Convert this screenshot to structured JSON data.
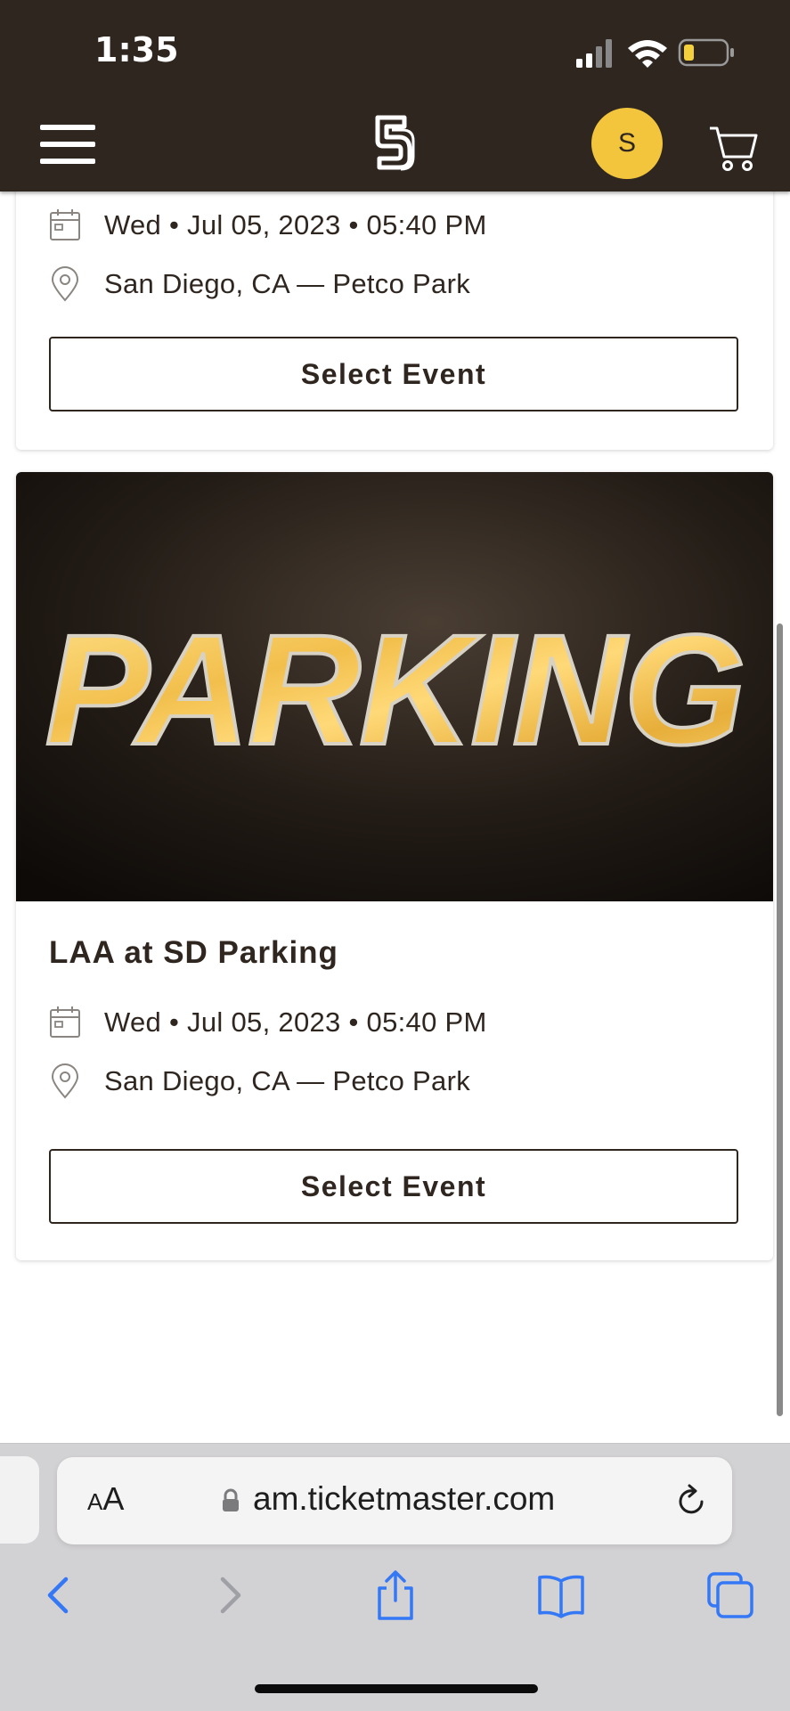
{
  "status_bar": {
    "time": "1:35"
  },
  "header": {
    "avatar_initial": "S",
    "brand_color": "#2f2620",
    "accent_color": "#f3c53c"
  },
  "events": [
    {
      "title": "",
      "date": "Wed • Jul 05, 2023 • 05:40 PM",
      "location": "San Diego, CA — Petco Park",
      "button_label": "Select Event"
    },
    {
      "image_text": "PARKING",
      "title": "LAA at SD Parking",
      "date": "Wed • Jul 05, 2023 • 05:40 PM",
      "location": "San Diego, CA — Petco Park",
      "button_label": "Select Event"
    }
  ],
  "browser": {
    "text_size_label_small": "A",
    "text_size_label_large": "A",
    "url": "am.ticketmaster.com",
    "toolbar_icons": [
      "back-icon",
      "forward-icon",
      "share-icon",
      "bookmarks-icon",
      "tabs-icon"
    ]
  }
}
